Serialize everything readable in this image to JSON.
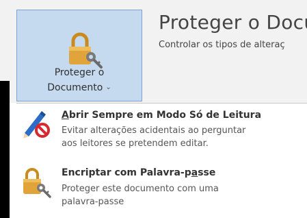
{
  "protect_button": {
    "line1": "Proteger o",
    "line2": "Documento",
    "chevron": "⌄"
  },
  "section": {
    "title": "Proteger o Docum",
    "description": "Controlar os tipos de alteraç"
  },
  "menu": {
    "items": [
      {
        "title_prefix": "",
        "title_accel": "A",
        "title_rest": "brir Sempre em Modo Só de Leitura",
        "description_line1": "Evitar alterações acidentais ao perguntar",
        "description_line2": "aos leitores se pretendem editar.",
        "icon": "pencil-prohibited-icon"
      },
      {
        "title_prefix": "Encriptar com Palavra-p",
        "title_accel": "a",
        "title_rest": "sse",
        "description_line1": "Proteger este documento com uma",
        "description_line2": "palavra-passe",
        "icon": "lock-key-icon"
      }
    ]
  },
  "colors": {
    "button_bg": "#c5d9ef",
    "button_border": "#7da2ce",
    "lock_gold": "#e0a43a",
    "prohibit_red": "#d8272e",
    "pencil_blue": "#2a6cc8"
  }
}
